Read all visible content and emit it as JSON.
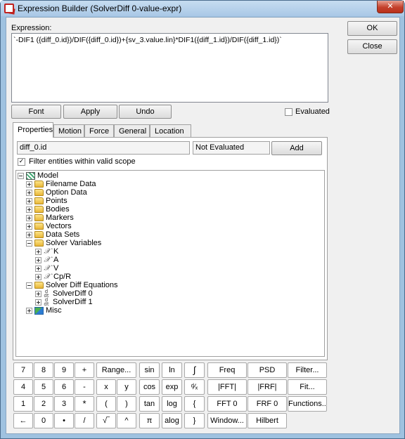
{
  "window": {
    "title": "Expression Builder (SolverDiff 0-value-expr)",
    "close_glyph": "✕"
  },
  "expression": {
    "label": "Expression:",
    "value": "`-DIF1 ({diff_0.id})/DIF({diff_0.id})+{sv_3.value.lin}*DIF1({diff_1.id})/DIF({diff_1.id})`"
  },
  "dialog_buttons": {
    "ok": "OK",
    "close": "Close"
  },
  "toolbar": {
    "font": "Font",
    "apply": "Apply",
    "undo": "Undo",
    "evaluated": "Evaluated"
  },
  "tabs": [
    "Properties",
    "Motion",
    "Force",
    "General",
    "Location"
  ],
  "properties": {
    "entity_field": "diff_0.id",
    "status_field": "Not Evaluated",
    "add": "Add",
    "filter_label": "Filter entities within valid scope",
    "filter_checked": "✓"
  },
  "tree": {
    "model": "Model",
    "folders": [
      "Filename Data",
      "Option Data",
      "Points",
      "Bodies",
      "Markers",
      "Vectors",
      "Data Sets"
    ],
    "solver_variables": "Solver Variables",
    "variables": [
      "K",
      "A",
      "V",
      "Cp/R"
    ],
    "solver_diff_equations": "Solver Diff Equations",
    "diffs": [
      "SolverDiff 0",
      "SolverDiff 1"
    ],
    "misc": "Misc"
  },
  "keypad": {
    "digits": [
      "7",
      "8",
      "9",
      "4",
      "5",
      "6",
      "1",
      "2",
      "3",
      "0"
    ],
    "ops": {
      "plus": "+",
      "minus": "-",
      "times": "*",
      "divide": "/",
      "dot": "•",
      "backspace": "←",
      "sqrt": "√‾",
      "power": "^",
      "pi": "π",
      "lparen": "(",
      "rparen": ")",
      "lbrace": "{",
      "rbrace": "}",
      "x": "x",
      "y": "y",
      "integral": "∫",
      "derivative": "ᵈ⁄ₓ"
    },
    "funcs": {
      "range": "Range...",
      "sin": "sin",
      "cos": "cos",
      "tan": "tan",
      "ln": "ln",
      "exp": "exp",
      "log": "log",
      "alog": "alog"
    },
    "signal": {
      "freq": "Freq",
      "psd": "PSD",
      "filter": "Filter...",
      "fft": "|FFT|",
      "frf": "|FRF|",
      "fit": "Fit...",
      "fft0": "FFT 0",
      "frf0": "FRF 0",
      "functions": "Functions...",
      "window": "Window...",
      "hilbert": "Hilbert"
    }
  }
}
